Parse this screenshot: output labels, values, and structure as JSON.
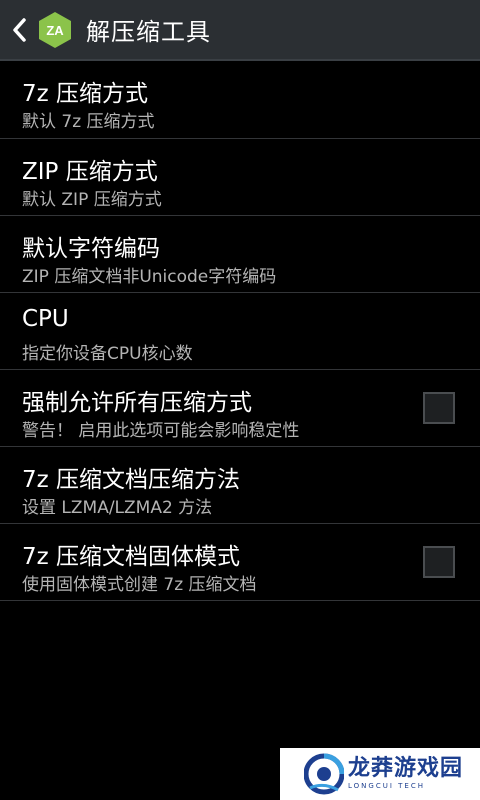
{
  "header": {
    "title": "解压缩工具",
    "app_icon_text": "ZA"
  },
  "settings": {
    "items": [
      {
        "title": "7z 压缩方式",
        "summary": "默认 7z 压缩方式"
      },
      {
        "title": "ZIP 压缩方式",
        "summary": "默认 ZIP 压缩方式"
      },
      {
        "title": "默认字符编码",
        "summary": "ZIP 压缩文档非Unicode字符编码"
      },
      {
        "title": "CPU",
        "summary": "指定你设备CPU核心数"
      },
      {
        "title": "强制允许所有压缩方式",
        "summary": "警告！ 启用此选项可能会影响稳定性",
        "checked": false
      },
      {
        "title": "7z 压缩文档压缩方法",
        "summary": "设置 LZMA/LZMA2 方法"
      },
      {
        "title": "7z 压缩文档固体模式",
        "summary": "使用固体模式创建 7z 压缩文档",
        "checked": false
      }
    ]
  },
  "watermark": {
    "name": "龙莽游戏园",
    "subtitle": "LONGCUI TECH"
  },
  "colors": {
    "actionbar": "#2b2f33",
    "background": "#000000",
    "app_icon_green": "#8bc34a",
    "summary_text": "#b4b4b4",
    "watermark_blue": "#1d3f8f"
  }
}
